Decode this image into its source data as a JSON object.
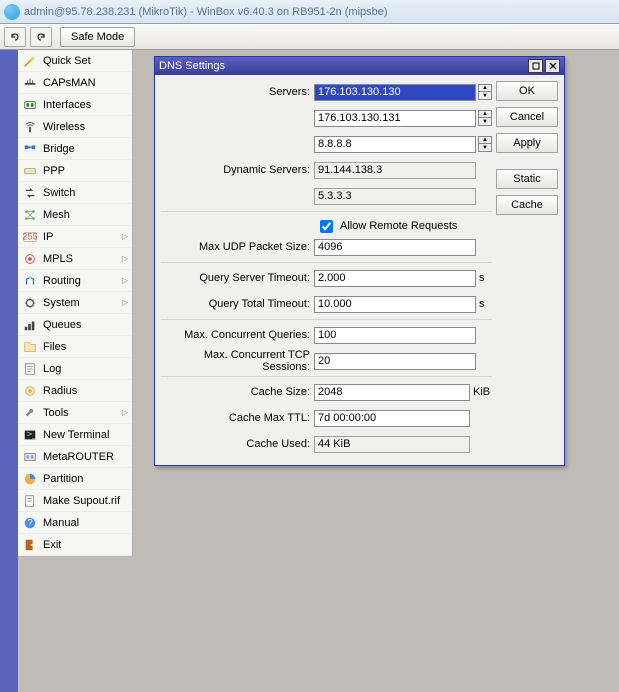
{
  "window": {
    "title": "admin@95.78.238.231 (MikroTik) - WinBox v6.40.3 on RB951-2n (mipsbe)"
  },
  "toolbar": {
    "safe_mode": "Safe Mode"
  },
  "sidebar": {
    "items": [
      {
        "label": "Quick Set",
        "arrow": false,
        "icon": "wand"
      },
      {
        "label": "CAPsMAN",
        "arrow": false,
        "icon": "caps"
      },
      {
        "label": "Interfaces",
        "arrow": false,
        "icon": "interfaces"
      },
      {
        "label": "Wireless",
        "arrow": false,
        "icon": "wireless"
      },
      {
        "label": "Bridge",
        "arrow": false,
        "icon": "bridge"
      },
      {
        "label": "PPP",
        "arrow": false,
        "icon": "ppp"
      },
      {
        "label": "Switch",
        "arrow": false,
        "icon": "switch"
      },
      {
        "label": "Mesh",
        "arrow": false,
        "icon": "mesh"
      },
      {
        "label": "IP",
        "arrow": true,
        "icon": "ip"
      },
      {
        "label": "MPLS",
        "arrow": true,
        "icon": "mpls"
      },
      {
        "label": "Routing",
        "arrow": true,
        "icon": "routing"
      },
      {
        "label": "System",
        "arrow": true,
        "icon": "system"
      },
      {
        "label": "Queues",
        "arrow": false,
        "icon": "queues"
      },
      {
        "label": "Files",
        "arrow": false,
        "icon": "files"
      },
      {
        "label": "Log",
        "arrow": false,
        "icon": "log"
      },
      {
        "label": "Radius",
        "arrow": false,
        "icon": "radius"
      },
      {
        "label": "Tools",
        "arrow": true,
        "icon": "tools"
      },
      {
        "label": "New Terminal",
        "arrow": false,
        "icon": "terminal"
      },
      {
        "label": "MetaROUTER",
        "arrow": false,
        "icon": "metarouter"
      },
      {
        "label": "Partition",
        "arrow": false,
        "icon": "partition"
      },
      {
        "label": "Make Supout.rif",
        "arrow": false,
        "icon": "supout"
      },
      {
        "label": "Manual",
        "arrow": false,
        "icon": "manual"
      },
      {
        "label": "Exit",
        "arrow": false,
        "icon": "exit"
      }
    ]
  },
  "dns": {
    "title": "DNS Settings",
    "labels": {
      "servers": "Servers:",
      "dynamic_servers": "Dynamic Servers:",
      "allow_remote": "Allow Remote Requests",
      "max_udp": "Max UDP Packet Size:",
      "query_server_timeout": "Query Server Timeout:",
      "query_total_timeout": "Query Total Timeout:",
      "max_concurrent_queries": "Max. Concurrent Queries:",
      "max_concurrent_tcp": "Max. Concurrent TCP Sessions:",
      "cache_size": "Cache Size:",
      "cache_max_ttl": "Cache Max TTL:",
      "cache_used": "Cache Used:",
      "unit_s": "s",
      "unit_kib": "KiB"
    },
    "values": {
      "servers": [
        "176.103.130.130",
        "176.103.130.131",
        "8.8.8.8"
      ],
      "dynamic_servers": [
        "91.144.138.3",
        "5.3.3.3"
      ],
      "allow_remote": true,
      "max_udp": "4096",
      "query_server_timeout": "2.000",
      "query_total_timeout": "10.000",
      "max_concurrent_queries": "100",
      "max_concurrent_tcp": "20",
      "cache_size": "2048",
      "cache_max_ttl": "7d 00:00:00",
      "cache_used": "44 KiB"
    },
    "buttons": {
      "ok": "OK",
      "cancel": "Cancel",
      "apply": "Apply",
      "static": "Static",
      "cache": "Cache"
    }
  }
}
